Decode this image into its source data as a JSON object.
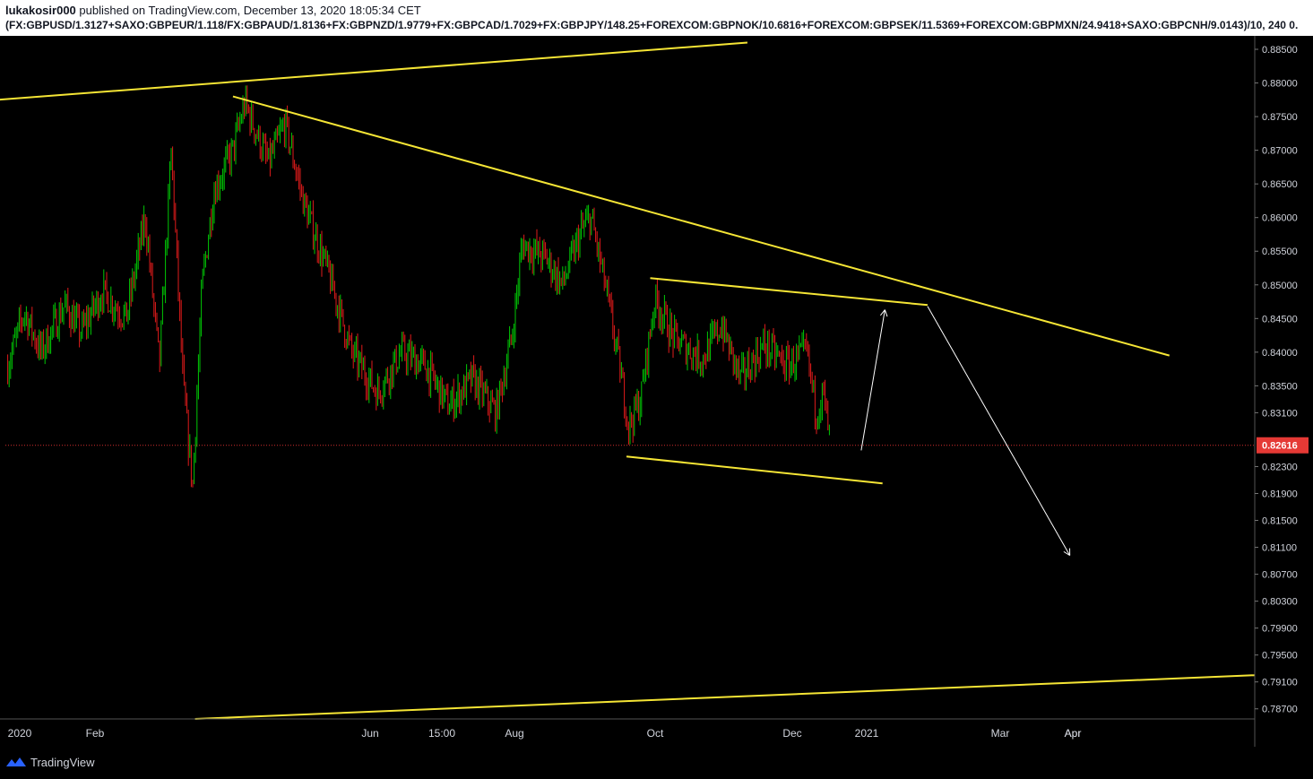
{
  "header": {
    "author": "lukakosir000",
    "published_text": " published on TradingView.com, December 13, 2020 18:05:34 CET",
    "symbol_formula": "(FX:GBPUSD/1.3127+SAXO:GBPEUR/1.118/FX:GBPAUD/1.8136+FX:GBPNZD/1.9779+FX:GBPCAD/1.7029+FX:GBPJPY/148.25+FOREXCOM:GBPNOK/10.6816+FOREXCOM:GBPSEK/11.5369+FOREXCOM:GBPMXN/24.9418+SAXO:GBPCNH/9.0143)/10, 240  0."
  },
  "footer": {
    "brand": "TradingView",
    "logo_icon": "tradingview-logo-icon"
  },
  "colors": {
    "background": "#000000",
    "up_candle": "#00c805",
    "down_candle": "#e01b1b",
    "trendline": "#f5e535",
    "arrow": "#ffffff",
    "price_line": "#d32f2f",
    "price_badge": "#e53935",
    "axis_text": "#d1d4dc"
  },
  "chart_data": {
    "type": "candlestick",
    "timeframe": "240",
    "x_ticks": [
      "2020",
      "Feb",
      "Apr",
      "Jun",
      "15:00",
      "Aug",
      "Oct",
      "Dec",
      "2021",
      "Mar",
      "Apr"
    ],
    "y_ticks": [
      "0.88500",
      "0.88000",
      "0.87500",
      "0.87000",
      "0.86500",
      "0.86000",
      "0.85500",
      "0.85000",
      "0.84500",
      "0.84000",
      "0.83500",
      "0.83100",
      "0.82300",
      "0.81900",
      "0.81500",
      "0.81100",
      "0.80700",
      "0.80300",
      "0.79900",
      "0.79500",
      "0.79100",
      "0.78700"
    ],
    "ylim": [
      0.7855,
      0.887
    ],
    "last_price": "0.82616",
    "price_path": [
      [
        "2020-01-01",
        0.838
      ],
      [
        "2020-01-08",
        0.846
      ],
      [
        "2020-01-15",
        0.84
      ],
      [
        "2020-01-25",
        0.847
      ],
      [
        "2020-02-01",
        0.843
      ],
      [
        "2020-02-10",
        0.849
      ],
      [
        "2020-02-20",
        0.845
      ],
      [
        "2020-02-28",
        0.86
      ],
      [
        "2020-03-05",
        0.838
      ],
      [
        "2020-03-10",
        0.87
      ],
      [
        "2020-03-15",
        0.835
      ],
      [
        "2020-03-19",
        0.82
      ],
      [
        "2020-03-23",
        0.85
      ],
      [
        "2020-03-28",
        0.864
      ],
      [
        "2020-04-05",
        0.87
      ],
      [
        "2020-04-10",
        0.877
      ],
      [
        "2020-04-20",
        0.868
      ],
      [
        "2020-04-27",
        0.874
      ],
      [
        "2020-05-05",
        0.862
      ],
      [
        "2020-05-15",
        0.852
      ],
      [
        "2020-05-25",
        0.84
      ],
      [
        "2020-06-05",
        0.834
      ],
      [
        "2020-06-15",
        0.84
      ],
      [
        "2020-06-25",
        0.838
      ],
      [
        "2020-07-05",
        0.832
      ],
      [
        "2020-07-15",
        0.836
      ],
      [
        "2020-07-25",
        0.831
      ],
      [
        "2020-08-01",
        0.843
      ],
      [
        "2020-08-05",
        0.856
      ],
      [
        "2020-08-15",
        0.854
      ],
      [
        "2020-08-22",
        0.85
      ],
      [
        "2020-08-30",
        0.858
      ],
      [
        "2020-09-03",
        0.86
      ],
      [
        "2020-09-09",
        0.85
      ],
      [
        "2020-09-15",
        0.838
      ],
      [
        "2020-09-19",
        0.829
      ],
      [
        "2020-09-24",
        0.833
      ],
      [
        "2020-09-30",
        0.848
      ],
      [
        "2020-10-08",
        0.842
      ],
      [
        "2020-10-20",
        0.839
      ],
      [
        "2020-10-28",
        0.844
      ],
      [
        "2020-11-05",
        0.836
      ],
      [
        "2020-11-15",
        0.841
      ],
      [
        "2020-11-25",
        0.838
      ],
      [
        "2020-12-03",
        0.84
      ],
      [
        "2020-12-07",
        0.831
      ],
      [
        "2020-12-10",
        0.834
      ],
      [
        "2020-12-13",
        0.8262
      ]
    ],
    "trendlines": [
      {
        "name": "upper-channel-line",
        "from": [
          "2019-12-28",
          0.8775
        ],
        "to": [
          "2020-11-08",
          0.886
        ]
      },
      {
        "name": "lower-channel-line",
        "from": [
          "2020-03-20",
          0.7855
        ],
        "to": [
          "2021-06-10",
          0.792
        ]
      },
      {
        "name": "descending-resistance",
        "from": [
          "2020-04-05",
          0.878
        ],
        "to": [
          "2021-05-05",
          0.8395
        ]
      },
      {
        "name": "flag-top-line",
        "from": [
          "2020-09-28",
          0.851
        ],
        "to": [
          "2021-01-23",
          0.847
        ]
      },
      {
        "name": "flag-bottom-line",
        "from": [
          "2020-09-18",
          0.8245
        ],
        "to": [
          "2021-01-04",
          0.8205
        ]
      }
    ],
    "arrows": [
      {
        "name": "projection-arrow-up",
        "from": [
          "2020-12-26",
          0.8254
        ],
        "to": [
          "2021-01-05",
          0.8463
        ]
      },
      {
        "name": "projection-arrow-down",
        "from": [
          "2021-01-23",
          0.8468
        ],
        "to": [
          "2021-03-24",
          0.8098
        ]
      }
    ]
  }
}
